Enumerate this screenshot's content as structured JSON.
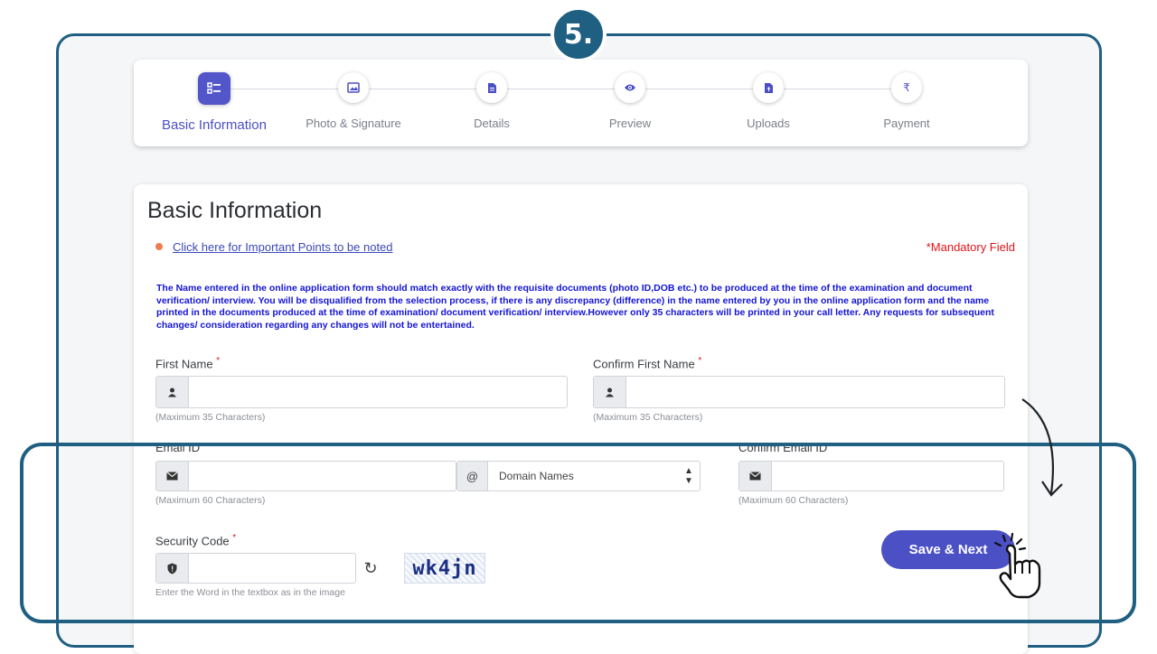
{
  "step_badge": "5.",
  "stepper": {
    "steps": [
      {
        "label": "Basic Information",
        "icon": "list-icon",
        "active": true
      },
      {
        "label": "Photo & Signature",
        "icon": "image-icon",
        "active": false
      },
      {
        "label": "Details",
        "icon": "document-icon",
        "active": false
      },
      {
        "label": "Preview",
        "icon": "eye-icon",
        "active": false
      },
      {
        "label": "Uploads",
        "icon": "upload-file-icon",
        "active": false
      },
      {
        "label": "Payment",
        "icon": "rupee-icon",
        "active": false
      }
    ]
  },
  "form": {
    "title": "Basic Information",
    "points_link": "Click here for Important Points to be noted",
    "mandatory": "*Mandatory Field",
    "notice": "The Name entered in the online application form should match exactly with the requisite documents (photo ID,DOB etc.) to be produced at the time of the examination and document verification/ interview. You will be disqualified from the selection process, if there is any discrepancy (difference) in the name entered by you in the online application form and the name printed in the documents produced at the time of examination/ document verification/ interview.However only 35 characters will be printed in your call letter. Any requests for subsequent changes/ consideration regarding any changes will not be entertained.",
    "first_name": {
      "label": "First Name",
      "required": "*",
      "value": "",
      "hint": "(Maximum 35 Characters)"
    },
    "confirm_first_name": {
      "label": "Confirm First Name",
      "required": "*",
      "value": "",
      "hint": "(Maximum 35 Characters)"
    },
    "email": {
      "label": "Email ID",
      "value": "",
      "hint": "(Maximum 60 Characters)",
      "at_symbol": "@",
      "domain_selected": "Domain Names"
    },
    "confirm_email": {
      "label": "Confirm Email ID",
      "value": "",
      "hint": "(Maximum 60 Characters)"
    },
    "security_code": {
      "label": "Security Code",
      "required": "*",
      "value": "",
      "hint": "Enter the Word in the textbox as in the image",
      "captcha_text": "wk4jn"
    },
    "save_button": "Save & Next"
  },
  "colors": {
    "accent": "#4c50c5",
    "frame": "#1f5f82",
    "required": "#e0161a",
    "notice": "#1414d4"
  }
}
